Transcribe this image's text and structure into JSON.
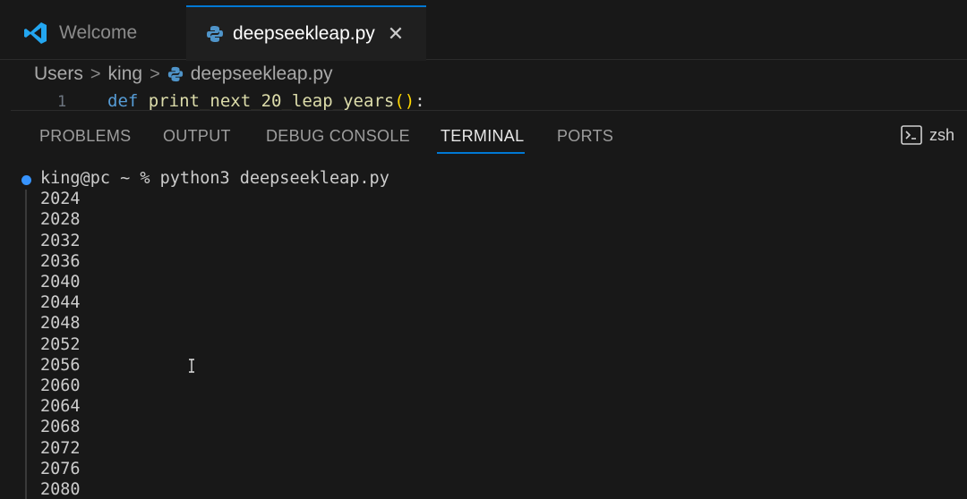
{
  "tabs": [
    {
      "label": "Welcome",
      "icon": "vscode-logo-icon",
      "active": false
    },
    {
      "label": "deepseekleap.py",
      "icon": "python-file-icon",
      "active": true,
      "close": "✕"
    }
  ],
  "breadcrumb": {
    "items": [
      "Users",
      "king",
      "deepseekleap.py"
    ],
    "separator": ">"
  },
  "editor": {
    "line_number": "1",
    "code": {
      "kw": "def",
      "name": "print_next_20_leap_years",
      "paren_open": "(",
      "paren_close": ")",
      "colon": ":"
    }
  },
  "panel": {
    "tabs": [
      "PROBLEMS",
      "OUTPUT",
      "DEBUG CONSOLE",
      "TERMINAL",
      "PORTS"
    ],
    "active_tab": "TERMINAL",
    "shell_label": "zsh"
  },
  "terminal": {
    "prompt": "king@pc ~ % python3 deepseekleap.py",
    "output": [
      "2024",
      "2028",
      "2032",
      "2036",
      "2040",
      "2044",
      "2048",
      "2052",
      "2056",
      "2060",
      "2064",
      "2068",
      "2072",
      "2076",
      "2080"
    ]
  },
  "colors": {
    "accent": "#0078d4",
    "background": "#181818",
    "keyword": "#569cd6",
    "function": "#dcdcaa"
  }
}
